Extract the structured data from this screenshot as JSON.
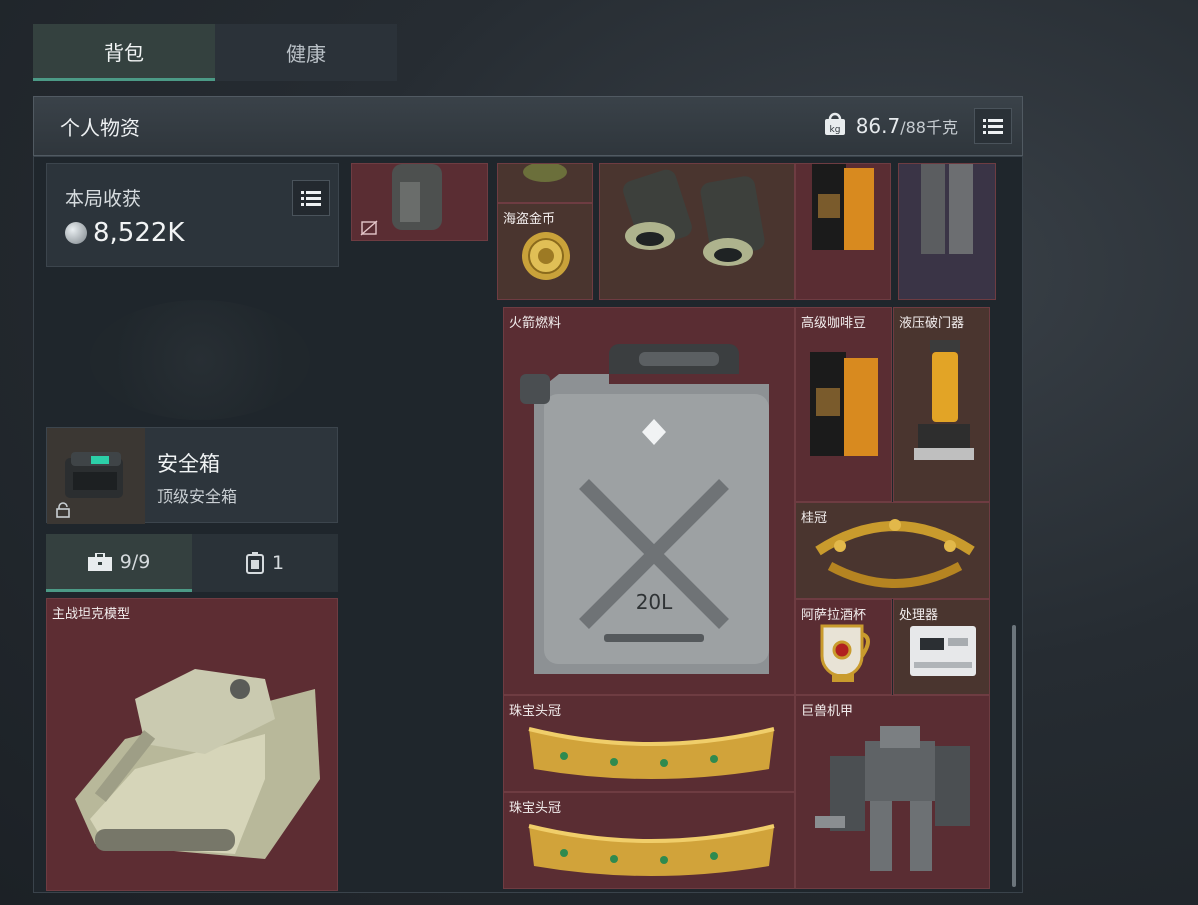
{
  "tabs": [
    {
      "label": "背包",
      "active": true
    },
    {
      "label": "健康",
      "active": false
    }
  ],
  "header": {
    "title": "个人物资",
    "weight": "86.7",
    "capacity": "/88千克"
  },
  "harvest": {
    "label": "本局收获",
    "value": "8,522K"
  },
  "safe": {
    "name": "安全箱",
    "subtitle": "顶级安全箱"
  },
  "subtabs": [
    {
      "label": "9/9",
      "icon": "briefcase-icon",
      "active": true
    },
    {
      "label": "1",
      "icon": "phone-icon",
      "active": false
    }
  ],
  "items": {
    "tank": "主战坦克模型",
    "pirate_coin": "海盗金币",
    "rocket_fuel": "火箭燃料",
    "premium_coffee": "高级咖啡豆",
    "hydraulic_breacher": "液压破门器",
    "laurel": "桂冠",
    "arena_cup": "阿萨拉酒杯",
    "processor": "处理器",
    "jewel_crown_1": "珠宝头冠",
    "jewel_crown_2": "珠宝头冠",
    "giant_mech": "巨兽机甲"
  },
  "colors": {
    "accent": "#4c9a86",
    "item_red": "#5a2d33",
    "item_gold": "#4a352f"
  }
}
